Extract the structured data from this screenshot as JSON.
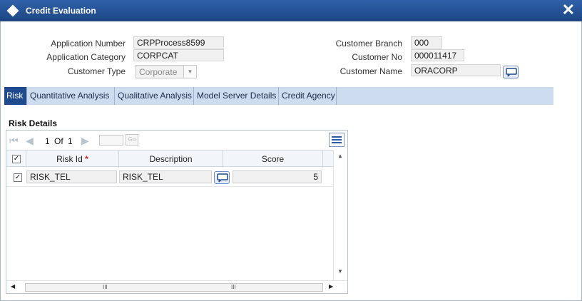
{
  "window": {
    "title": "Credit Evaluation",
    "close_label": "✕"
  },
  "form": {
    "application_number": {
      "label": "Application Number",
      "value": "CRPProcess8599"
    },
    "application_category": {
      "label": "Application Category",
      "value": "CORPCAT"
    },
    "customer_type": {
      "label": "Customer Type",
      "value": "Corporate"
    },
    "customer_branch": {
      "label": "Customer Branch",
      "value": "000"
    },
    "customer_no": {
      "label": "Customer No",
      "value": "000011417"
    },
    "customer_name": {
      "label": "Customer Name",
      "value": "ORACORP"
    }
  },
  "tabs": [
    {
      "label": "Risk",
      "active": true
    },
    {
      "label": "Quantitative Analysis",
      "active": false
    },
    {
      "label": "Qualitative Analysis",
      "active": false
    },
    {
      "label": "Model Server Details",
      "active": false
    },
    {
      "label": "Credit Agency",
      "active": false
    }
  ],
  "risk": {
    "section_title": "Risk Details",
    "pager": {
      "current": "1",
      "of_label": "Of",
      "total": "1",
      "go_label": "Go"
    },
    "columns": {
      "risk_id": "Risk Id",
      "description": "Description",
      "score": "Score",
      "required_mark": "*"
    },
    "rows": [
      {
        "checked": true,
        "risk_id": "RISK_TEL",
        "description": "RISK_TEL",
        "score": "5"
      }
    ],
    "scroll_grip": "III"
  },
  "colors": {
    "title_bar": "#1d4585",
    "tab_active": "#1f4a8e",
    "tab_bar": "#cddcee"
  }
}
